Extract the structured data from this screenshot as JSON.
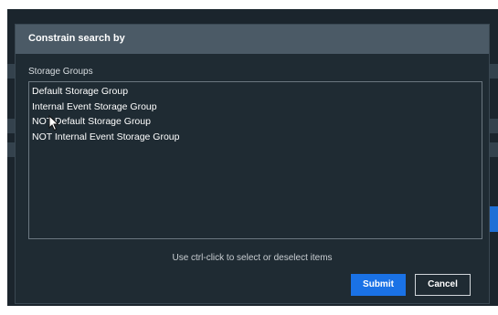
{
  "dialog": {
    "title": "Constrain search by",
    "field_label": "Storage Groups",
    "items": [
      "Default Storage Group",
      "Internal Event Storage Group",
      "NOT Default Storage Group",
      "NOT Internal Event Storage Group"
    ],
    "hint": "Use ctrl-click to select or deselect items",
    "submit_label": "Submit",
    "cancel_label": "Cancel"
  },
  "colors": {
    "header": "#4b5a66",
    "dialog_bg": "#1f2b33",
    "accent": "#1a72e6"
  },
  "icons": {
    "pointer": "mouse-pointer-icon"
  }
}
